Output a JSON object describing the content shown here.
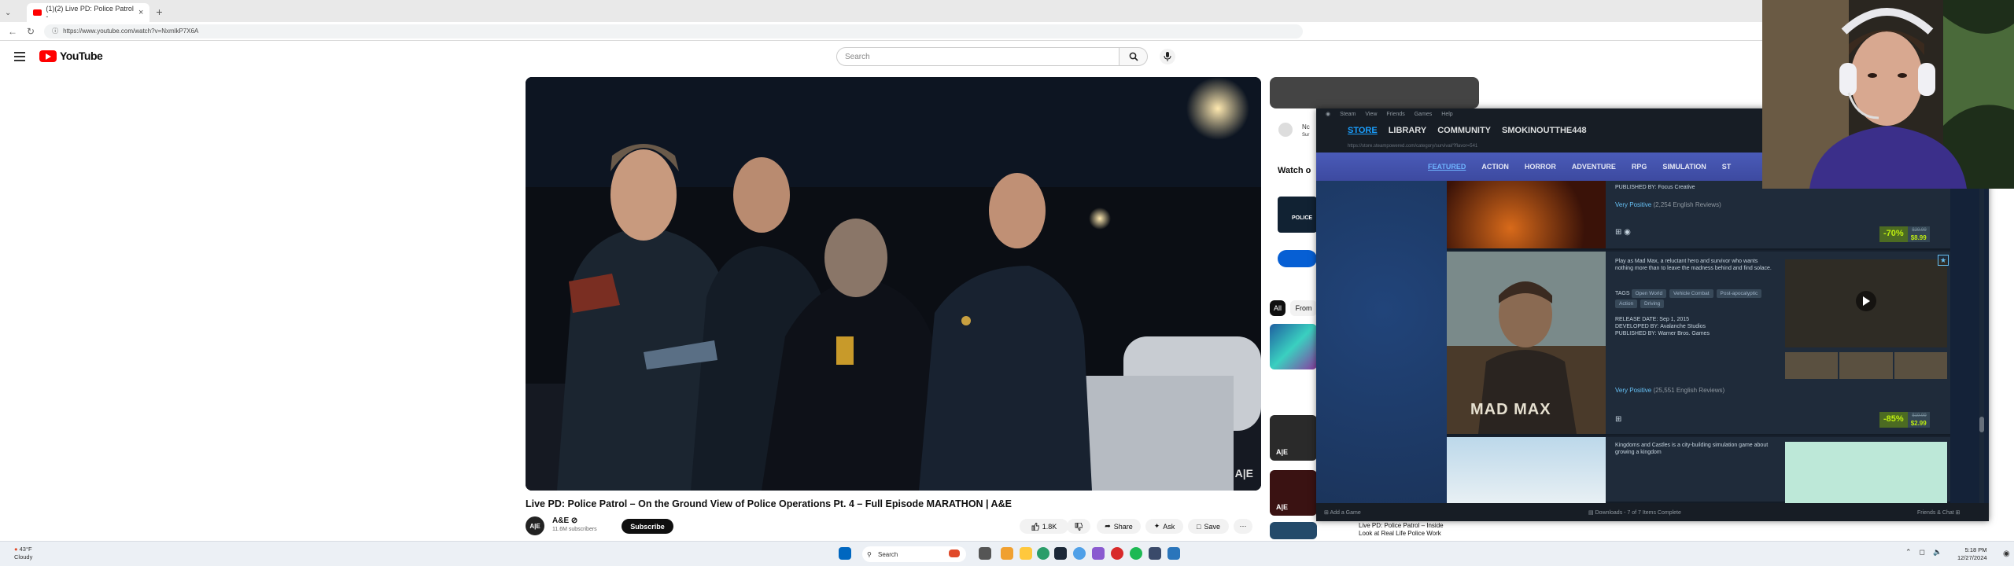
{
  "browser": {
    "tab_title": "(1)(2) Live PD: Police Patrol -",
    "tab_close": "×",
    "new_tab": "+",
    "tab_menu": "⌄",
    "url": "https://www.youtube.com/watch?v=NxmlkP7X6A"
  },
  "youtube": {
    "logo": "YouTube",
    "search_placeholder": "Search",
    "video_watermark": "A|E",
    "video_title": "Live PD: Police Patrol – On the Ground View of Police Operations Pt. 4 – Full Episode MARATHON | A&E",
    "channel": {
      "avatar_text": "A|E",
      "name": "A&E ⊘",
      "subs": "11.6M subscribers",
      "subscribe": "Subscribe"
    },
    "actions": {
      "like": "1.8K",
      "share": "Share",
      "ask": "Ask",
      "save": "Save",
      "more": "⋯"
    },
    "sidebar": {
      "card_text": "Nc",
      "card_sub": "Sur",
      "watch_heading": "Watch o",
      "thumb_text": "POLICE",
      "chips": [
        "All",
        "From"
      ],
      "bottom_title": "Live PD: Police Patrol – Inside",
      "bottom_sub": "Look at Real Life Police Work"
    }
  },
  "steam": {
    "menu": [
      "Steam",
      "View",
      "Friends",
      "Games",
      "Help"
    ],
    "nav": [
      "STORE",
      "LIBRARY",
      "COMMUNITY",
      "SMOKINOUTTHE448"
    ],
    "url": "https://store.steampowered.com/category/survival/?flavor=541",
    "tabs": [
      "FEATURED",
      "ACTION",
      "HORROR",
      "ADVENTURE",
      "RPG",
      "SIMULATION",
      "ST"
    ],
    "games": [
      {
        "published": "PUBLISHED BY: Focus Creative",
        "review": "Very Positive",
        "review_count": "(2,254 English Reviews)",
        "discount": "-70%",
        "orig_price": "$29.99",
        "price": "$8.99"
      },
      {
        "title_art": "MAD MAX",
        "description": "Play as Mad Max, a reluctant hero and survivor who wants nothing more than to leave the madness behind and find solace.",
        "tags_label": "TAGS",
        "tags": [
          "Open World",
          "Vehicle Combat",
          "Post-apocalyptic",
          "Action",
          "Driving"
        ],
        "release": "RELEASE DATE: Sep 1, 2015",
        "developer": "DEVELOPED BY: Avalanche Studios",
        "publisher": "PUBLISHED BY: Warner Bros. Games",
        "review": "Very Positive",
        "review_count": "(25,551 English Reviews)",
        "discount": "-85%",
        "orig_price": "$19.99",
        "price": "$2.99"
      },
      {
        "description": "Kingdoms and Castles is a city-building simulation game about growing a kingdom"
      }
    ],
    "footer": {
      "add_game": "Add a Game",
      "downloads": "Downloads - 7 of 7 Items Complete",
      "friends": "Friends & Chat"
    }
  },
  "taskbar": {
    "weather_temp": "43°F",
    "weather_desc": "Cloudy",
    "search": "Search",
    "time": "5:18 PM",
    "date": "12/27/2024"
  },
  "colors": {
    "yt_red": "#ff0000",
    "steam_bg": "#1b2838",
    "steam_accent": "#1a9fff",
    "discount_green": "#4c6b22"
  }
}
